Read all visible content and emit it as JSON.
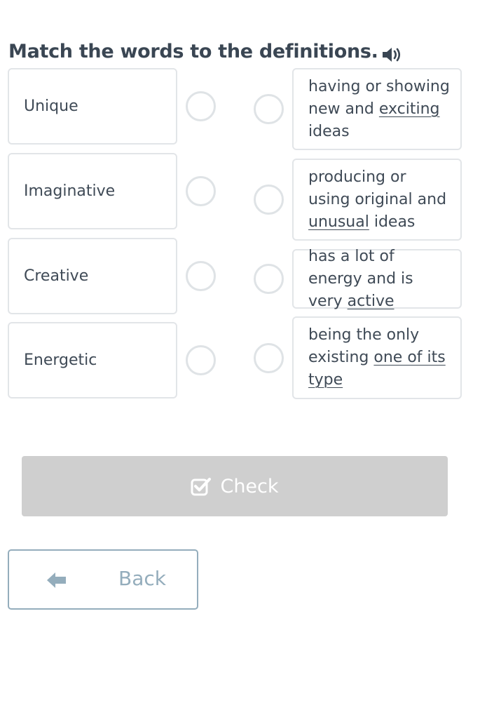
{
  "exercise": {
    "title": "Match the words to the definitions.",
    "audio_icon": "speaker-icon"
  },
  "words": [
    {
      "label": "Unique"
    },
    {
      "label": "Imaginative"
    },
    {
      "label": "Creative"
    },
    {
      "label": "Energetic"
    }
  ],
  "definitions": [
    {
      "parts": [
        {
          "text": "having or showing new and "
        },
        {
          "text": "exciting",
          "underline": true
        },
        {
          "text": " ideas"
        }
      ]
    },
    {
      "parts": [
        {
          "text": "producing or using original and "
        },
        {
          "text": "unusual",
          "underline": true
        },
        {
          "text": " ideas"
        }
      ]
    },
    {
      "parts": [
        {
          "text": "has a lot of energy and is very "
        },
        {
          "text": "active",
          "underline": true
        }
      ]
    },
    {
      "parts": [
        {
          "text": "being the only existing "
        },
        {
          "text": "one of its type",
          "underline": true
        }
      ]
    }
  ],
  "actions": {
    "check_label": "Check",
    "check_icon": "checkbox-check-icon",
    "back_label": "Back",
    "back_icon": "arrow-left-icon"
  },
  "colors": {
    "check_button_bg": "#cfcfcf",
    "back_button_accent": "#94adbc",
    "text": "#3f4a56",
    "card_border": "#e2e5e8"
  }
}
